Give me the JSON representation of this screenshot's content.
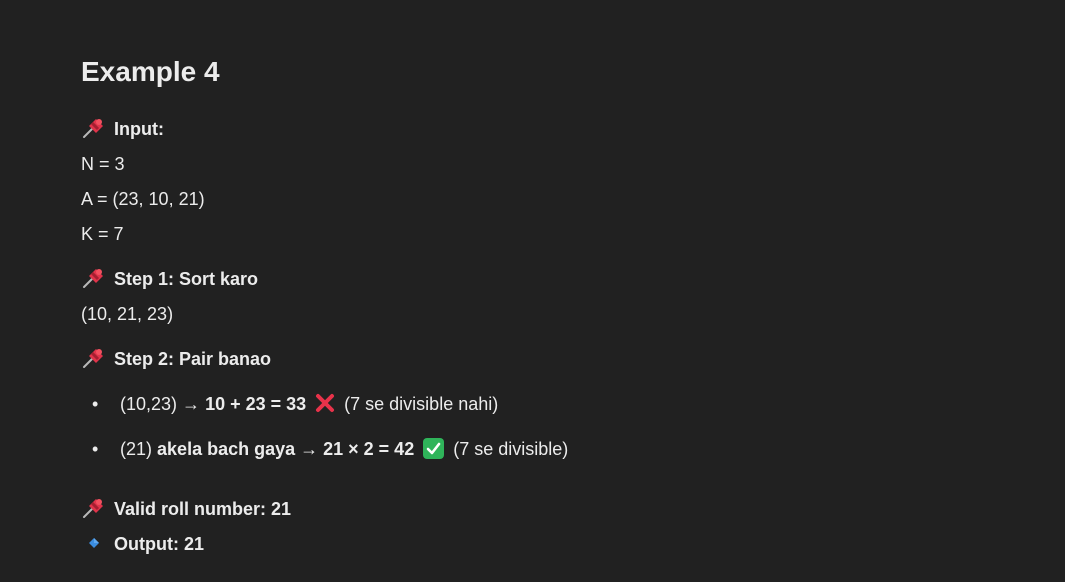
{
  "title": "Example 4",
  "input": {
    "label": "Input:",
    "lines": [
      "N = 3",
      "A = (23, 10, 21)",
      "K = 7"
    ]
  },
  "step1": {
    "label": "Step 1: Sort karo",
    "result": "(10, 21, 23)"
  },
  "step2": {
    "label": "Step 2: Pair banao",
    "items": [
      {
        "pair": "(10,23) →",
        "calc": "10 + 23 = 33",
        "note": "(7 se divisible nahi)"
      },
      {
        "pair": "(21)",
        "calc": "akela bach gaya → 21 × 2 = 42",
        "note": "(7 se divisible)"
      }
    ]
  },
  "valid": {
    "label": "Valid roll number: 21"
  },
  "output": {
    "label": "Output: 21"
  },
  "icons": {
    "pin": "pushpin-icon",
    "cross": "cross-mark-icon",
    "check": "check-mark-icon",
    "diamond": "blue-diamond-icon"
  },
  "colors": {
    "background": "#212121",
    "text": "#ececec",
    "pin": "#e0334a",
    "cross": "#e8324a",
    "check": "#2fb45a",
    "diamond": "#3b8de0"
  }
}
